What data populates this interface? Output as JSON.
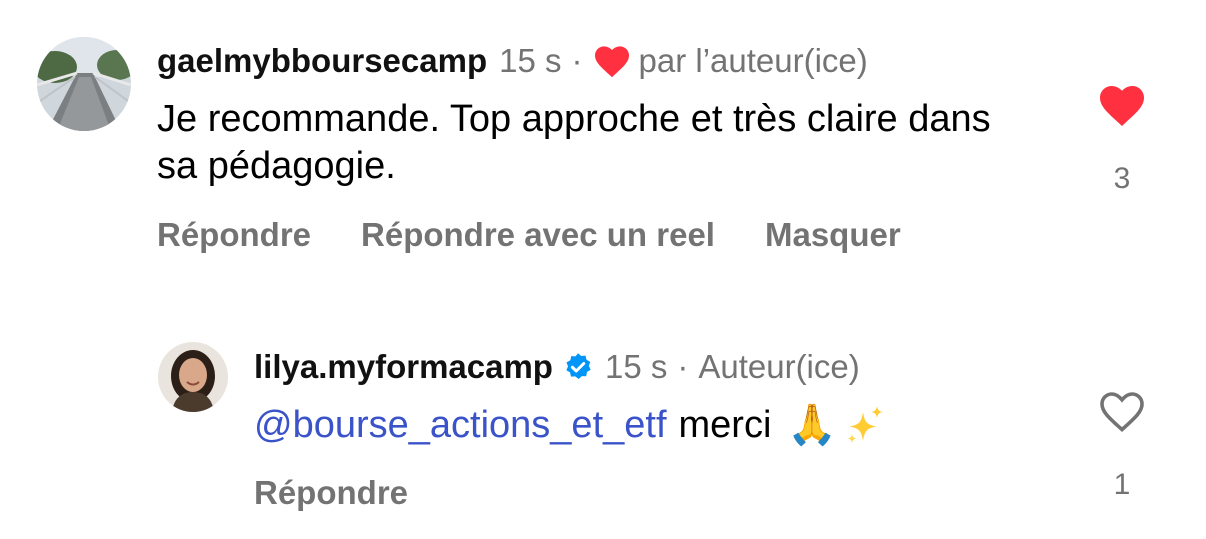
{
  "comments": [
    {
      "username": "gaelmybboursecamp",
      "time": "15 s",
      "separator": "·",
      "liked_by_author_label": "par l’auteur(ice)",
      "text": "Je recommande. Top approche et très claire dans sa pédagogie.",
      "likes": "3",
      "liked": true,
      "actions": {
        "reply": "Répondre",
        "reply_reel": "Répondre avec un reel",
        "hide": "Masquer"
      },
      "avatar_icon": "bridge-photo"
    },
    {
      "username": "lilya.myformacamp",
      "verified": true,
      "time": "15 s",
      "separator": "·",
      "author_label": "Auteur(ice)",
      "mention": "@bourse_actions_et_etf",
      "text": "merci",
      "emoji": "🙏",
      "sparkles": "sparkles-icon",
      "likes": "1",
      "liked": false,
      "actions": {
        "reply": "Répondre"
      },
      "avatar_icon": "person-photo"
    }
  ],
  "colors": {
    "like_red": "#ff3040",
    "verified_blue": "#0095f6",
    "mention_blue": "#3a53c9",
    "meta_gray": "#737373"
  }
}
